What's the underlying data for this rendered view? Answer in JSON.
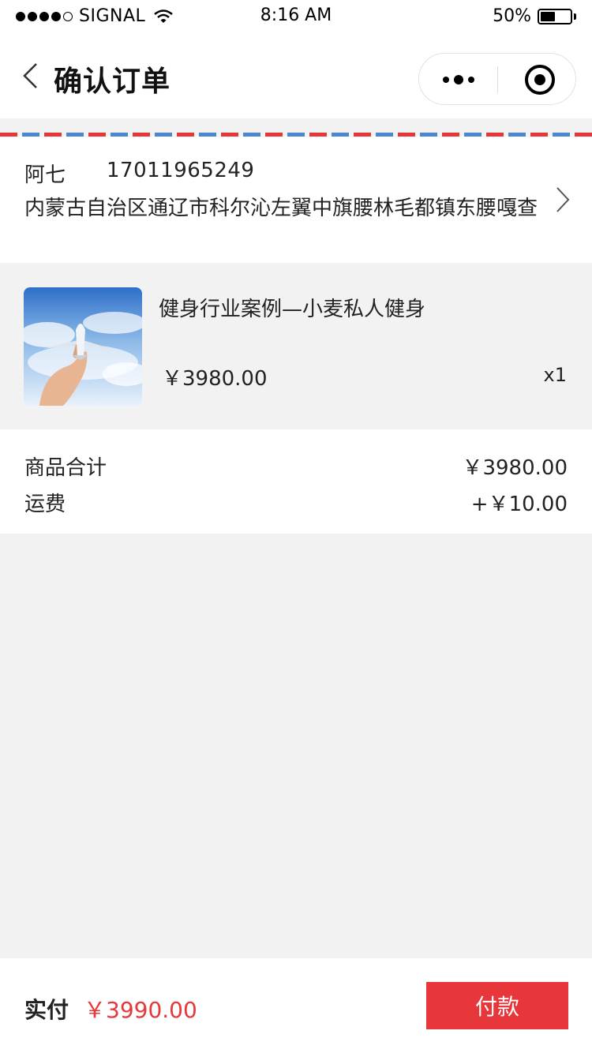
{
  "status_bar": {
    "carrier": "SIGNAL",
    "time": "8:16 AM",
    "battery": "50%",
    "battery_level": 0.5
  },
  "nav": {
    "title": "确认订单",
    "back_icon": "chevron-left-icon",
    "more_icon": "more-dots-icon",
    "close_icon": "target-circle-icon"
  },
  "address": {
    "name": "阿七",
    "phone": "17011965249",
    "detail": "内蒙古自治区通辽市科尔沁左翼中旗腰林毛都镇东腰嘎查"
  },
  "product": {
    "title": "健身行业案例—小麦私人健身",
    "price": "￥3980.00",
    "quantity": "x1",
    "image_icon": "airplane-in-hand-photo"
  },
  "summary": {
    "subtotal_label": "商品合计",
    "subtotal_value": "￥3980.00",
    "shipping_label": "运费",
    "shipping_value": "+￥10.00"
  },
  "footer": {
    "pay_label": "实付",
    "pay_amount": "￥3990.00",
    "pay_button": "付款"
  },
  "colors": {
    "accent_red": "#e8373a",
    "airmail_blue": "#4b87d2",
    "background": "#f2f2f2"
  }
}
